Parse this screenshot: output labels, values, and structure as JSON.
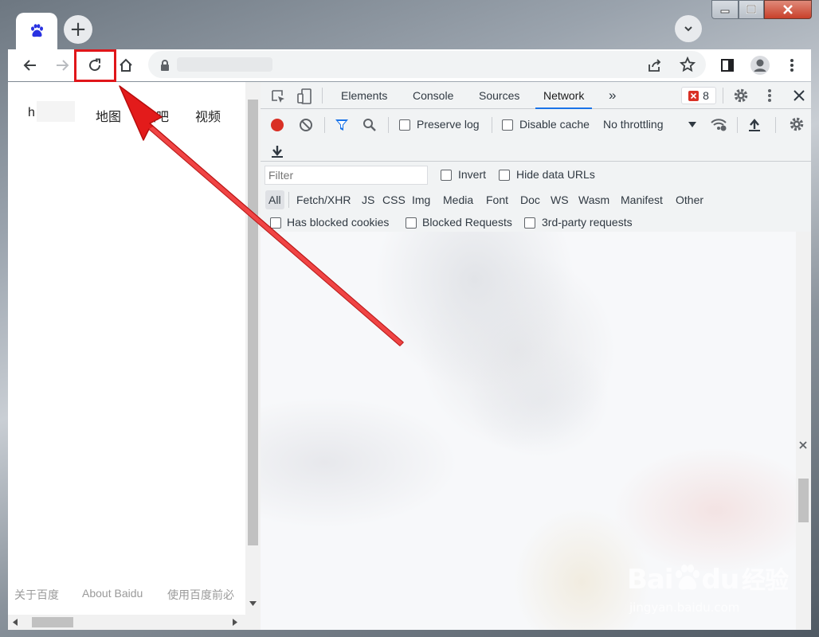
{
  "browser": {
    "tab": {
      "favicon": "baidu-paw-icon"
    },
    "new_tab_label": "+",
    "tab_search_icon": "chevron-down-icon",
    "window_controls": [
      "minimize-icon",
      "maximize-icon",
      "close-icon"
    ]
  },
  "toolbar": {
    "back_icon": "back-arrow-icon",
    "forward_icon": "forward-arrow-icon",
    "reload_icon": "reload-icon",
    "home_icon": "home-icon",
    "lock_icon": "lock-icon",
    "share_icon": "share-icon",
    "bookmark_icon": "star-icon",
    "side_panel_icon": "side-panel-icon",
    "profile_icon": "profile-icon",
    "menu_icon": "kebab-menu-icon"
  },
  "page": {
    "nav": {
      "item1": "h",
      "map": "地图",
      "tieba": "贴吧",
      "video": "视频"
    },
    "footer": {
      "about_cn": "关于百度",
      "about_en": "About Baidu",
      "terms": "使用百度前必"
    }
  },
  "devtools": {
    "tabs": {
      "elements": "Elements",
      "console": "Console",
      "sources": "Sources",
      "network": "Network",
      "more": "»"
    },
    "error_count": "8",
    "network_toolbar": {
      "preserve_log": "Preserve log",
      "disable_cache": "Disable cache",
      "throttling": "No throttling"
    },
    "filter": {
      "placeholder": "Filter",
      "invert": "Invert",
      "hide_data_urls": "Hide data URLs",
      "types": {
        "all": "All",
        "fetch": "Fetch/XHR",
        "js": "JS",
        "css": "CSS",
        "img": "Img",
        "media": "Media",
        "font": "Font",
        "doc": "Doc",
        "ws": "WS",
        "wasm": "Wasm",
        "manifest": "Manifest",
        "other": "Other"
      },
      "has_blocked_cookies": "Has blocked cookies",
      "blocked_requests": "Blocked Requests",
      "third_party": "3rd-party requests"
    }
  },
  "annotation": {
    "highlight_color": "#e0161a",
    "arrow_color": "#e31b1b"
  },
  "watermark": {
    "brand": "Bai",
    "brand2": "du",
    "cn": "经验",
    "url": "jingyan.baidu.com"
  }
}
